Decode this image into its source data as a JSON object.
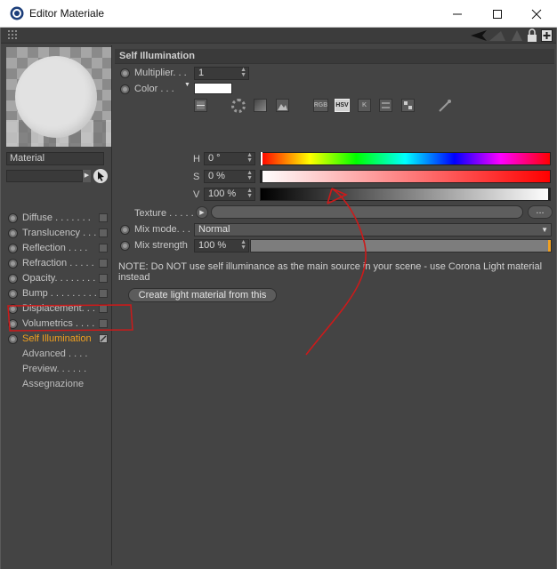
{
  "window": {
    "title": "Editor Materiale",
    "controls": {
      "minimize": "minimize-icon",
      "maximize": "maximize-icon",
      "close": "close-icon"
    }
  },
  "toolbar": {
    "icons": [
      "grip-icon",
      "arrow-left-icon",
      "arrow-up-icon",
      "lock-icon",
      "new-window-icon"
    ]
  },
  "material": {
    "name": "Material"
  },
  "channels": [
    {
      "label": "Diffuse . . . . . . .",
      "active": false
    },
    {
      "label": "Translucency . . .",
      "active": false
    },
    {
      "label": "Reflection . . . .",
      "active": false
    },
    {
      "label": "Refraction . . . . .",
      "active": false
    },
    {
      "label": "Opacity. . . . . . . .",
      "active": false
    },
    {
      "label": "Bump . . . . . . . . .",
      "active": false
    },
    {
      "label": "Displacement. . .",
      "active": false
    },
    {
      "label": "Volumetrics . . . .",
      "active": false
    },
    {
      "label": "Self Illumination",
      "active": true
    }
  ],
  "subitems": [
    "Advanced . . . .",
    "Preview. . . . . .",
    "Assegnazione"
  ],
  "section": {
    "title": "Self Illumination",
    "multiplier_label": "Multiplier. . .",
    "multiplier_value": "1",
    "color_label": "Color . . .",
    "color_value": "#ffffff",
    "mode_icons": [
      "texture-icon",
      "color-wheel-icon",
      "spectrum-icon",
      "image-icon",
      "RGB",
      "HSV",
      "K",
      "sliders-icon",
      "swatches-icon",
      "eyedropper-icon"
    ],
    "mode_selected": "HSV",
    "h_label": "H",
    "h_value": "0 °",
    "s_label": "S",
    "s_value": "0 %",
    "v_label": "V",
    "v_value": "100 %",
    "texture_label": "Texture . . . . .",
    "texture_more": "...",
    "mix_mode_label": "Mix mode. . .",
    "mix_mode_value": "Normal",
    "mix_strength_label": "Mix strength",
    "mix_strength_value": "100 %",
    "mix_strength_level": 1.0,
    "note": "NOTE: Do NOT use self illuminance as the main source in your scene - use Corona Light material instead",
    "create_button": "Create light material from this"
  },
  "colors": {
    "accent_active": "#f0a020",
    "annotation": "#cc1a1a",
    "panel_bg": "#444444"
  }
}
